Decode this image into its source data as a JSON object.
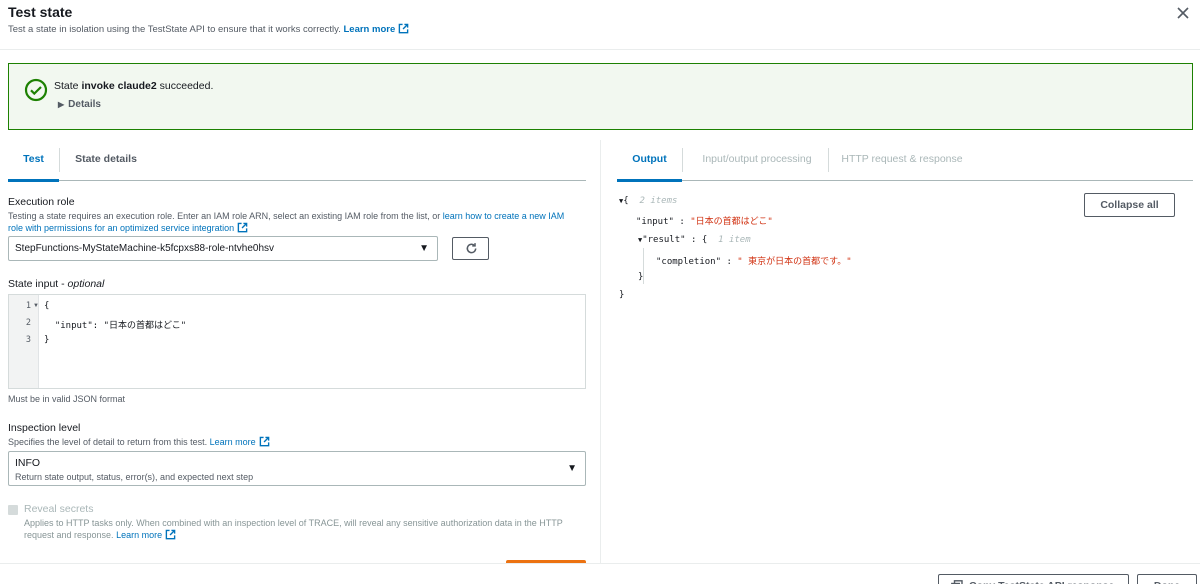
{
  "header": {
    "title": "Test state",
    "subtitle": "Test a state in isolation using the TestState API to ensure that it works correctly.",
    "learn_more": "Learn more"
  },
  "flash": {
    "prefix": "State ",
    "state_name": "invoke claude2",
    "suffix": " succeeded.",
    "details_label": "Details",
    "color": "#1d8102"
  },
  "left_tabs": [
    "Test",
    "State details"
  ],
  "execution_role": {
    "label": "Execution role",
    "desc_prefix": "Testing a state requires an execution role. Enter an IAM role ARN, select an existing IAM role from the list, or ",
    "desc_link_1": "learn how to create a new IAM",
    "desc_link_2": "role with permissions for an optimized service integration",
    "selected": "StepFunctions-MyStateMachine-k5fcpxs88-role-ntvhe0hsv"
  },
  "state_input": {
    "label": "State input",
    "optional": "optional",
    "dash": " - ",
    "lines": [
      "{",
      "  \"input\": \"日本の首都はどこ\"",
      "}"
    ],
    "line_numbers": [
      "1",
      "2",
      "3"
    ],
    "hint": "Must be in valid JSON format"
  },
  "inspection": {
    "label": "Inspection level",
    "desc": "Specifies the level of detail to return from this test.",
    "learn_more": "Learn more",
    "value": "INFO",
    "value_desc": "Return state output, status, error(s), and expected next step"
  },
  "reveal": {
    "label": "Reveal secrets",
    "desc_1": "Applies to HTTP tasks only. When combined with an inspection level of TRACE, will reveal any sensitive authorization data in the HTTP",
    "desc_2": "request and response.",
    "learn_more": "Learn more"
  },
  "right_tabs": [
    "Output",
    "Input/output processing",
    "HTTP request & response"
  ],
  "output": {
    "collapse_all": "Collapse all",
    "root_open": "{",
    "root_count": "2 items",
    "input_key": "\"input\"",
    "input_value": "\"日本の首都はどこ\"",
    "result_key": "\"result\"",
    "result_open": "{",
    "result_count": "1 item",
    "completion_key": "\"completion\"",
    "completion_value": "\" 東京が日本の首都です。\"",
    "result_close": "}",
    "root_close": "}",
    "colon": " : "
  },
  "footer": {
    "copy_button": "Copy TestState API response",
    "done_button": "Done"
  },
  "colors": {
    "link": "#0073bb",
    "primary": "#ec7211",
    "success": "#1d8102",
    "json_string": "#d13212"
  }
}
